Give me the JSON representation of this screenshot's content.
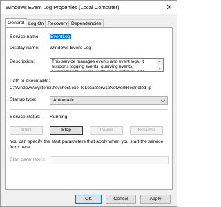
{
  "window": {
    "title": "Windows Event Log Properties (Local Computer)",
    "close_glyph": "✕"
  },
  "tabs": [
    {
      "label": "General",
      "active": true
    },
    {
      "label": "Log On",
      "active": false
    },
    {
      "label": "Recovery",
      "active": false
    },
    {
      "label": "Dependencies",
      "active": false
    }
  ],
  "general": {
    "service_name_label": "Service name:",
    "service_name_value": "EventLog",
    "display_name_label": "Display name:",
    "display_name_value": "Windows Event Log",
    "description_label": "Description:",
    "description_value": "This service manages events and event logs. It supports logging events, querying events, subscribing to events, archiving event logs, and",
    "path_label": "Path to executable:",
    "path_value": "C:\\Windows\\System32\\svchost.exe -k LocalServiceNetworkRestricted -p",
    "startup_type_label": "Startup type:",
    "startup_type_value": "Automatic",
    "service_status_label": "Service status:",
    "service_status_value": "Running",
    "buttons": {
      "start": "Start",
      "stop": "Stop",
      "pause": "Pause",
      "resume": "Resume"
    },
    "info_text": "You can specify the start parameters that apply when you start the service from here.",
    "start_params_label": "Start parameters:",
    "start_params_value": ""
  },
  "footer": {
    "ok": "OK",
    "cancel": "Cancel",
    "apply": "Apply"
  },
  "colors": {
    "selection": "#0078d7",
    "panel": "#ffffff",
    "chrome": "#f0f0f0"
  }
}
